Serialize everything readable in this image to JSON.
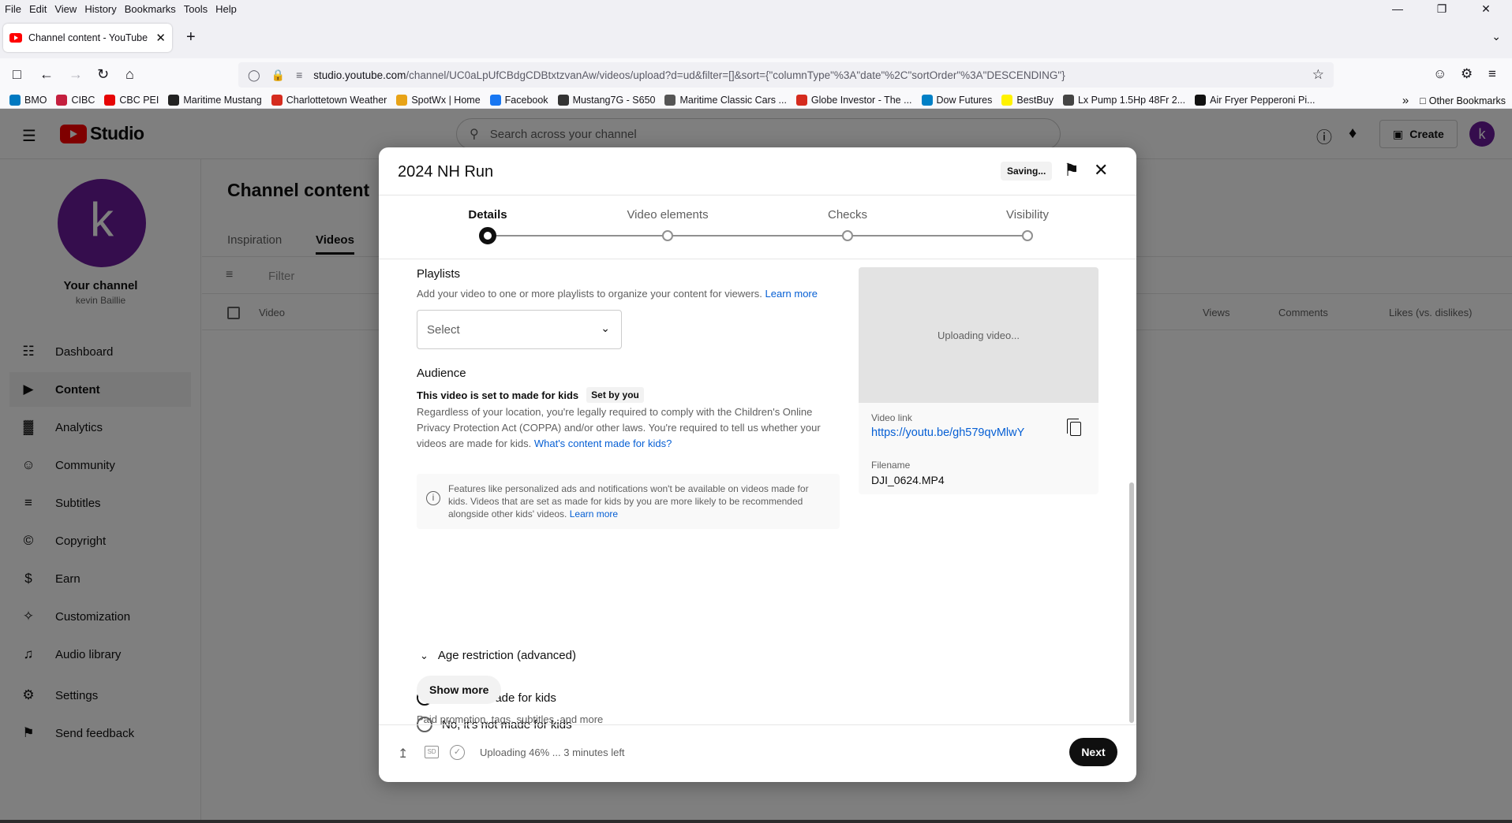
{
  "browser": {
    "menu": [
      "File",
      "Edit",
      "View",
      "History",
      "Bookmarks",
      "Tools",
      "Help"
    ],
    "tab_title": "Channel content - YouTube Stu",
    "url_host": "studio.youtube.com",
    "url_path": "/channel/UC0aLpUfCBdgCDBtxtzvanAw/videos/upload?d=ud&filter=[]&sort={\"columnType\"%3A\"date\"%2C\"sortOrder\"%3A\"DESCENDING\"}",
    "bookmarks": [
      {
        "label": "BMO",
        "color": "#0079c1"
      },
      {
        "label": "CIBC",
        "color": "#c41f3e"
      },
      {
        "label": "CBC PEI",
        "color": "#e60505"
      },
      {
        "label": "Maritime Mustang",
        "color": "#222222"
      },
      {
        "label": "Charlottetown Weather",
        "color": "#d52b1e"
      },
      {
        "label": "SpotWx | Home",
        "color": "#e8a317"
      },
      {
        "label": "Facebook",
        "color": "#1877f2"
      },
      {
        "label": "Mustang7G - S650",
        "color": "#333333"
      },
      {
        "label": "Maritime Classic Cars ...",
        "color": "#555555"
      },
      {
        "label": "Globe Investor - The ...",
        "color": "#d52b1e"
      },
      {
        "label": "Dow Futures",
        "color": "#0080c6"
      },
      {
        "label": "BestBuy",
        "color": "#fff200"
      },
      {
        "label": "Lx Pump 1.5Hp 48Fr 2...",
        "color": "#444444"
      },
      {
        "label": "Air Fryer Pepperoni Pi...",
        "color": "#111111"
      }
    ],
    "other_bookmarks": "Other Bookmarks"
  },
  "studio": {
    "logo_text": "Studio",
    "search_placeholder": "Search across your channel",
    "create_label": "Create",
    "avatar_letter": "k",
    "channel_title": "Your channel",
    "channel_name": "kevin Baillie",
    "nav": [
      {
        "label": "Dashboard",
        "icon": "dashboard-icon"
      },
      {
        "label": "Content",
        "icon": "content-icon"
      },
      {
        "label": "Analytics",
        "icon": "analytics-icon"
      },
      {
        "label": "Community",
        "icon": "community-icon"
      },
      {
        "label": "Subtitles",
        "icon": "subtitles-icon"
      },
      {
        "label": "Copyright",
        "icon": "copyright-icon"
      },
      {
        "label": "Earn",
        "icon": "earn-icon"
      },
      {
        "label": "Customization",
        "icon": "customization-icon"
      },
      {
        "label": "Audio library",
        "icon": "audio-library-icon"
      }
    ],
    "settings_label": "Settings",
    "feedback_label": "Send feedback",
    "page_title": "Channel content",
    "tabs": [
      "Inspiration",
      "Videos"
    ],
    "filter_placeholder": "Filter",
    "columns": {
      "video": "Video",
      "views": "Views",
      "comments": "Comments",
      "likes": "Likes (vs. dislikes)"
    }
  },
  "dialog": {
    "title": "2024 NH Run",
    "saving": "Saving...",
    "steps": [
      "Details",
      "Video elements",
      "Checks",
      "Visibility"
    ],
    "playlists": {
      "title": "Playlists",
      "desc": "Add your video to one or more playlists to organize your content for viewers.",
      "learn_more": "Learn more",
      "select": "Select"
    },
    "audience": {
      "title": "Audience",
      "status": "This video is set to made for kids",
      "badge": "Set by you",
      "desc": "Regardless of your location, you're legally required to comply with the Children's Online Privacy Protection Act (COPPA) and/or other laws. You're required to tell us whether your videos are made for kids.",
      "desc_link": "What's content made for kids?",
      "info": "Features like personalized ads and notifications won't be available on videos made for kids. Videos that are set as made for kids by you are more likely to be recommended alongside other kids' videos.",
      "info_link": "Learn more",
      "yes": "Yes, it's made for kids",
      "no": "No, it's not made for kids"
    },
    "age_restriction": "Age restriction (advanced)",
    "show_more": "Show more",
    "show_more_desc": "Paid promotion, tags, subtitles, and more",
    "preview": {
      "uploading": "Uploading video...",
      "link_label": "Video link",
      "link": "https://youtu.be/gh579qvMlwY",
      "filename_label": "Filename",
      "filename": "DJI_0624.MP4"
    },
    "footer": {
      "hd_label": "SD",
      "status": "Uploading 46% ... 3 minutes left",
      "next": "Next"
    }
  }
}
